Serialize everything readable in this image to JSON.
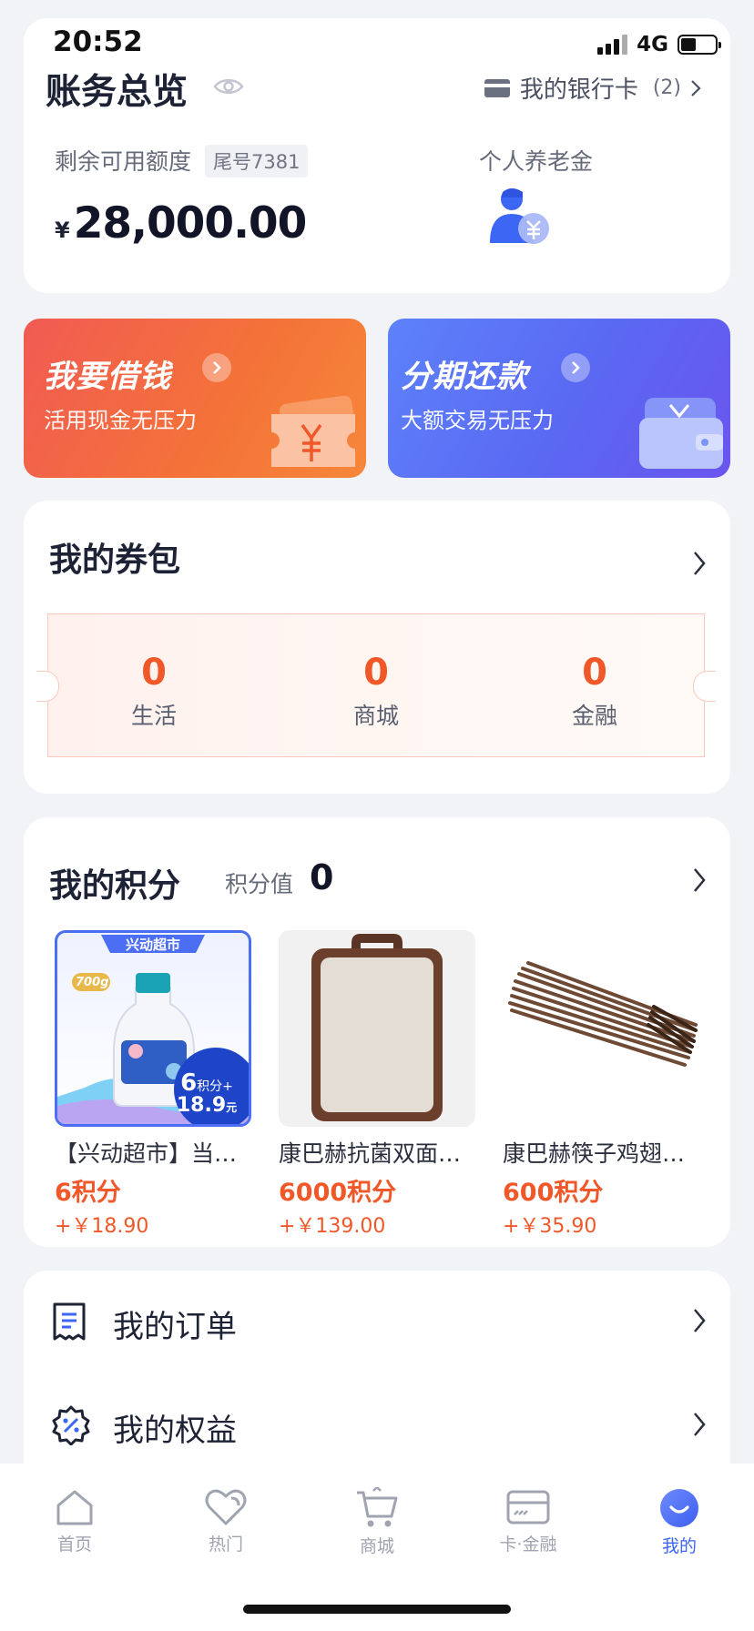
{
  "status_bar": {
    "time": "20:52",
    "network": "4G"
  },
  "account": {
    "title": "账务总览",
    "bank_card_label": "我的银行卡",
    "bank_card_count": "(2)",
    "balance_label": "剩余可用额度",
    "card_tail": "尾号7381",
    "currency": "¥",
    "balance": "28,000.00",
    "pension_label": "个人养老金"
  },
  "promos": [
    {
      "title": "我要借钱",
      "subtitle": "活用现金无压力"
    },
    {
      "title": "分期还款",
      "subtitle": "大额交易无压力"
    }
  ],
  "coupons": {
    "title": "我的券包",
    "items": [
      {
        "value": "0",
        "label": "生活"
      },
      {
        "value": "0",
        "label": "商城"
      },
      {
        "value": "0",
        "label": "金融"
      }
    ]
  },
  "points": {
    "title": "我的积分",
    "value_label": "积分值",
    "value": "0",
    "products": [
      {
        "name": "【兴动超市】当…",
        "points": "6积分",
        "price": "+￥18.90",
        "banner": "兴动超市",
        "tag_weight": "700g",
        "badge_pts": "6",
        "badge_pts_unit": "积分+",
        "badge_price": "18.9",
        "badge_unit": "元"
      },
      {
        "name": "康巴赫抗菌双面…",
        "points": "6000积分",
        "price": "+￥139.00"
      },
      {
        "name": "康巴赫筷子鸡翅…",
        "points": "600积分",
        "price": "+￥35.90"
      }
    ]
  },
  "menu": [
    {
      "label": "我的订单",
      "icon": "order-receipt-icon"
    },
    {
      "label": "我的权益",
      "icon": "benefits-badge-icon"
    }
  ],
  "tabs": [
    {
      "label": "首页",
      "icon": "home-icon"
    },
    {
      "label": "热门",
      "icon": "heart-icon"
    },
    {
      "label": "商城",
      "icon": "cart-icon"
    },
    {
      "label": "卡·金融",
      "icon": "card-icon"
    },
    {
      "label": "我的",
      "icon": "profile-icon",
      "active": true
    }
  ],
  "colors": {
    "accent": "#3c66f4",
    "points_orange": "#f0582a",
    "promo_red": "#f15b53",
    "promo_blue": "#5a68f2"
  }
}
